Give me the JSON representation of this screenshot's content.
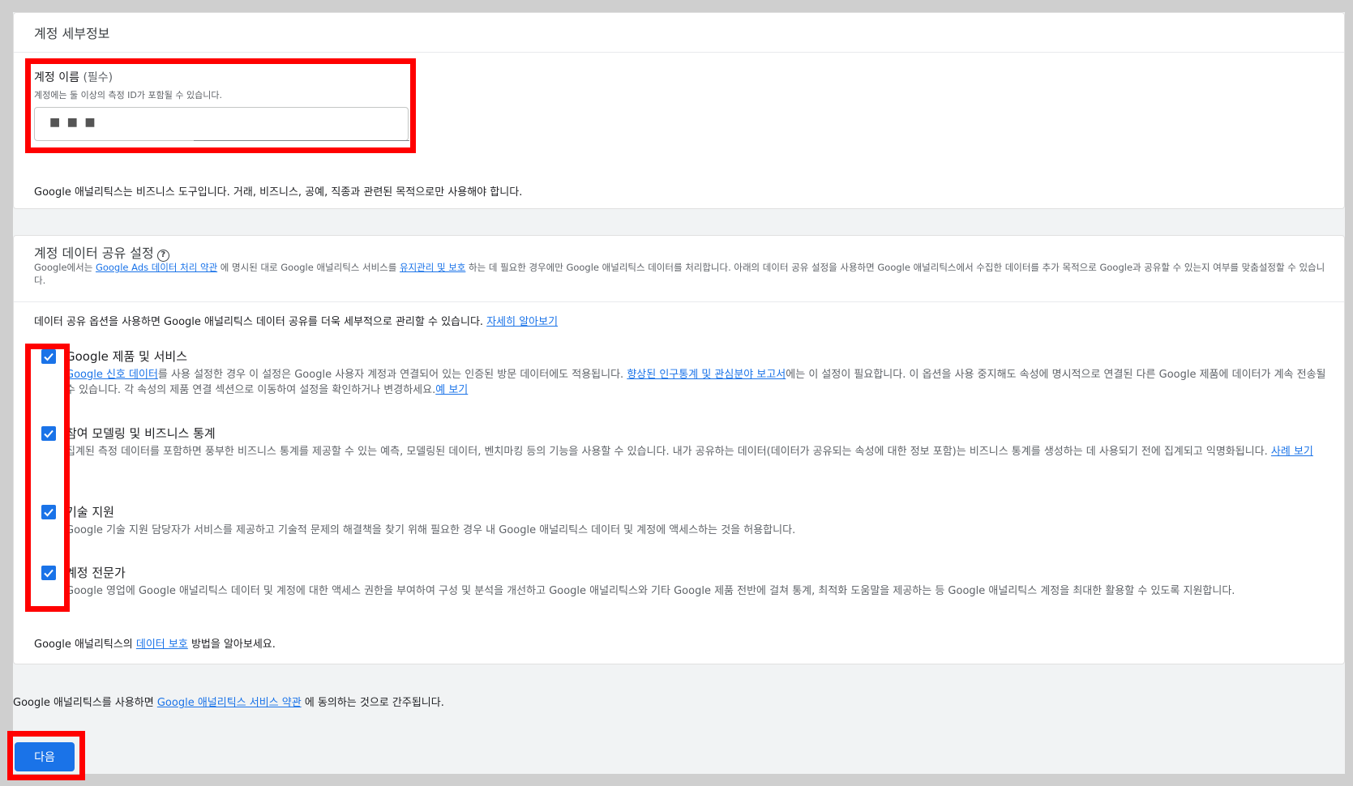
{
  "account_details": {
    "title": "계정 세부정보",
    "name_label": "계정 이름",
    "name_required": "(필수)",
    "name_help": "계정에는 둘 이상의 측정 ID가 포함될 수 있습니다.",
    "name_value": "■ ■ ■",
    "business_notice": "Google 애널리틱스는 비즈니스 도구입니다. 거래, 비즈니스, 공예, 직종과 관련된 목적으로만 사용해야 합니다."
  },
  "data_sharing": {
    "title": "계정 데이터 공유 설정",
    "info_icon": "help-circle-icon",
    "desc_prefix": "Google에서는 ",
    "desc_link1": "Google Ads 데이터 처리 약관",
    "desc_mid1": " 에 명시된 대로 Google 애널리틱스 서비스를 ",
    "desc_link2": "유지관리 및 보호",
    "desc_suffix": " 하는 데 필요한 경우에만 Google 애널리틱스 데이터를 처리합니다. 아래의 데이터 공유 설정을 사용하면 Google 애널리틱스에서 수집한 데이터를 추가 목적으로 Google과 공유할 수 있는지 여부를 맞춤설정할 수 있습니다.",
    "intro": "데이터 공유 옵션을 사용하면 Google 애널리틱스 데이터 공유를 더욱 세부적으로 관리할 수 있습니다. ",
    "intro_link": "자세히 알아보기",
    "options": [
      {
        "title": "Google 제품 및 서비스",
        "checked": true,
        "link1": "Google 신호 데이터",
        "text1": "를 사용 설정한 경우 이 설정은 Google 사용자 계정과 연결되어 있는 인증된 방문 데이터에도 적용됩니다. ",
        "link2": "향상된 인구통계 및 관심분야 보고서",
        "text2": "에는 이 설정이 필요합니다. 이 옵션을 사용 중지해도 속성에 명시적으로 연결된 다른 Google 제품에 데이터가 계속 전송될 수 있습니다. 각 속성의 제품 연결 섹션으로 이동하여 설정을 확인하거나 변경하세요.",
        "link3": "예 보기"
      },
      {
        "title": "참여 모델링 및 비즈니스 통계",
        "checked": true,
        "text1": "집계된 측정 데이터를 포함하면 풍부한 비즈니스 통계를 제공할 수 있는 예측, 모델링된 데이터, 벤치마킹 등의 기능을 사용할 수 있습니다. 내가 공유하는 데이터(데이터가 공유되는 속성에 대한 정보 포함)는 비즈니스 통계를 생성하는 데 사용되기 전에 집계되고 익명화됩니다. ",
        "link1": "사례 보기"
      },
      {
        "title": "기술 지원",
        "checked": true,
        "text1": "Google 기술 지원 담당자가 서비스를 제공하고 기술적 문제의 해결책을 찾기 위해 필요한 경우 내 Google 애널리틱스 데이터 및 계정에 액세스하는 것을 허용합니다."
      },
      {
        "title": "계정 전문가",
        "checked": true,
        "text1": "Google 영업에 Google 애널리틱스 데이터 및 계정에 대한 액세스 권한을 부여하여 구성 및 분석을 개선하고 Google 애널리틱스와 기타 Google 제품 전반에 걸쳐 통계, 최적화 도움말을 제공하는 등 Google 애널리틱스 계정을 최대한 활용할 수 있도록 지원합니다."
      }
    ],
    "protection_prefix": "Google 애널리틱스의 ",
    "protection_link": "데이터 보호",
    "protection_suffix": " 방법을 알아보세요."
  },
  "footer": {
    "terms_prefix": "Google 애널리틱스를 사용하면 ",
    "terms_link": "Google 애널리틱스 서비스 약관",
    "terms_suffix": " 에 동의하는 것으로 간주됩니다.",
    "next_label": "다음"
  },
  "colors": {
    "accent": "#1a73e8",
    "highlight": "#ff0000"
  }
}
